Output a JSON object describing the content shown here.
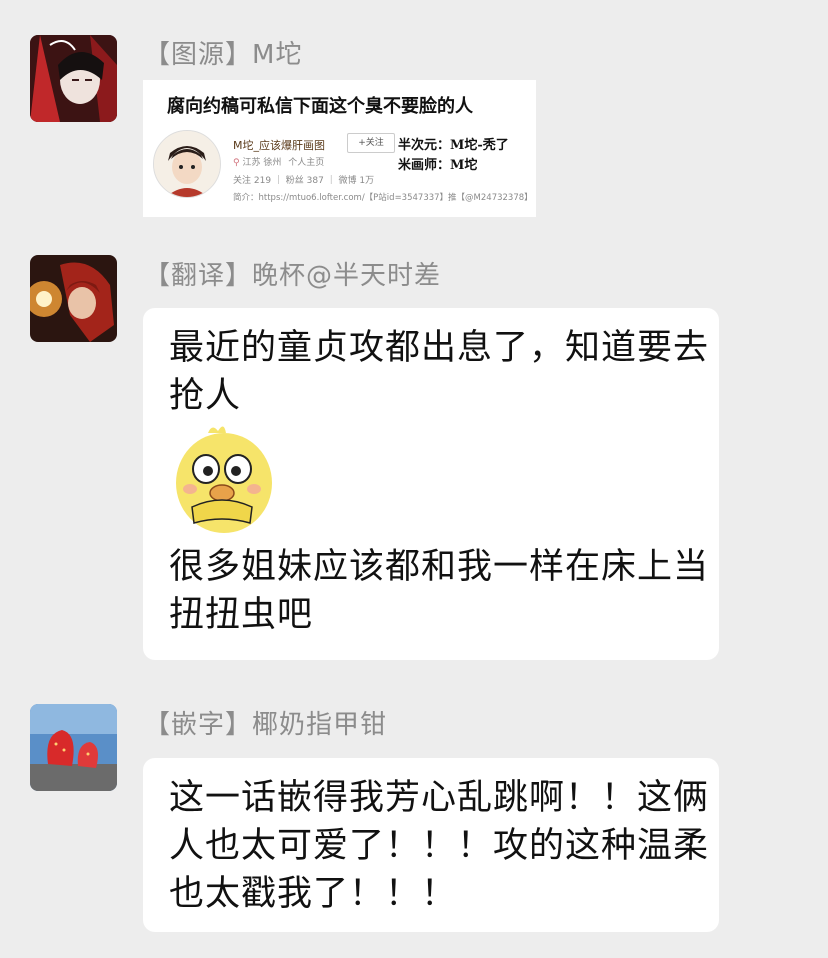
{
  "messages": [
    {
      "sender": "【图源】M坨",
      "card": {
        "title": "腐向约稿可私信下面这个臭不要脸的人",
        "username": "M坨_应该爆肝画图",
        "follow_label": "+关注",
        "location": "江苏 徐州",
        "homepage_label": "个人主页",
        "stats": "关注 219 ｜ 粉丝 387 ｜ 微博 1万",
        "bio": "简介：https://mtuo6.lofter.com/【P站id=3547337】推【@M24732378】",
        "side_line1": "半次元：M坨-秃了",
        "side_line2": "米画师：M坨"
      }
    },
    {
      "sender": "【翻译】晚杯@半天时差",
      "text1": "最近的童贞攻都出息了，知道要去抢人",
      "sticker": "surprised-duck-sticker",
      "text2": "很多姐妹应该都和我一样在床上当扭扭虫吧"
    },
    {
      "sender": "【嵌字】椰奶指甲钳",
      "text": "这一话嵌得我芳心乱跳啊！！这俩人也太可爱了！！！攻的这种温柔也太戳我了！！！"
    }
  ],
  "colors": {
    "background": "#ededed",
    "bubble": "#ffffff",
    "sender_text": "#8c8c8c",
    "message_text": "#111111"
  }
}
